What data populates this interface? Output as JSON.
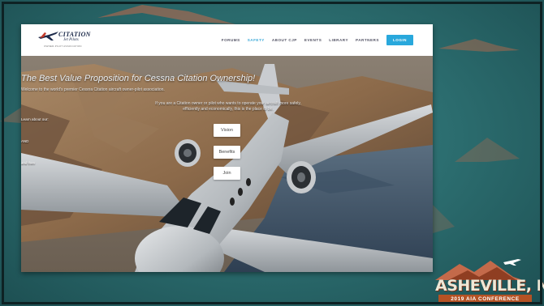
{
  "site": {
    "logo": {
      "title": "CITATION",
      "subtitle": "Jet Pilots",
      "tagline": "OWNER-PILOT ASSOCIATION"
    },
    "nav": {
      "items": [
        "FORUMS",
        "SAFETY",
        "ABOUT CJP",
        "EVENTS",
        "LIBRARY",
        "PARTNERS"
      ],
      "active_index": 1,
      "login_label": "LOGIN"
    },
    "hero": {
      "headline": "The Best Value Proposition for Cessna Citation Ownership!",
      "welcome": "Welcome to the world's premier Cessna Citation aircraft owner-pilot association.",
      "intro": "If you are a Citation owner or pilot who wants to operate your aircraft more safely, efficiently and economically, this is the place to be.",
      "learn_prompt": "Learn about our:",
      "vision_label": "Vision",
      "and_label": "AND",
      "benefits_label": "Benefits",
      "and_then_label": "and then",
      "join_label": "Join"
    }
  },
  "conference": {
    "city": "ASHEVILLE, NC",
    "banner": "2019 AIA CONFERENCE"
  },
  "colors": {
    "slide_bg": "#2c6e70",
    "mountain_accent": "#c46a4a",
    "login_button": "#29a8dc",
    "active_nav": "#3aa8d8",
    "banner": "#b55224"
  }
}
